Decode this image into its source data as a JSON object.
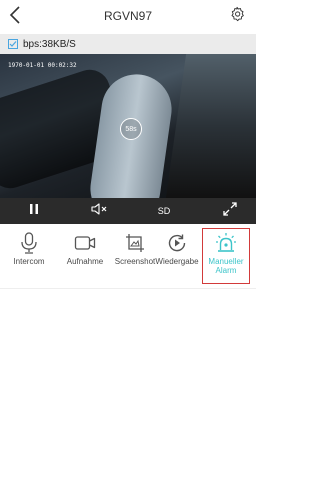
{
  "header": {
    "title": "RGVN97",
    "back_icon": "chevron-left-icon",
    "settings_icon": "gear-icon"
  },
  "status": {
    "bitrate": "bps:38KB/S"
  },
  "video": {
    "timestamp": "1970-01-01 00:02:32",
    "countdown": "58s"
  },
  "controls": {
    "pause_icon": "pause-icon",
    "mute_icon": "speaker-muted-icon",
    "quality_label": "SD",
    "fullscreen_icon": "fullscreen-icon"
  },
  "actions": [
    {
      "label": "Intercom",
      "icon": "microphone-icon"
    },
    {
      "label": "Aufnahme",
      "icon": "video-camera-icon"
    },
    {
      "label": "Screenshot",
      "icon": "image-icon"
    },
    {
      "label": "Wiedergabe",
      "icon": "replay-icon"
    },
    {
      "label": "Manueller Alarm",
      "icon": "alarm-siren-icon",
      "active": true
    }
  ],
  "colors": {
    "accent": "#3cc4c9",
    "highlight_border": "#d23a3a",
    "controls_bar": "#2b2b2b",
    "info_bar": "#ebebeb"
  }
}
